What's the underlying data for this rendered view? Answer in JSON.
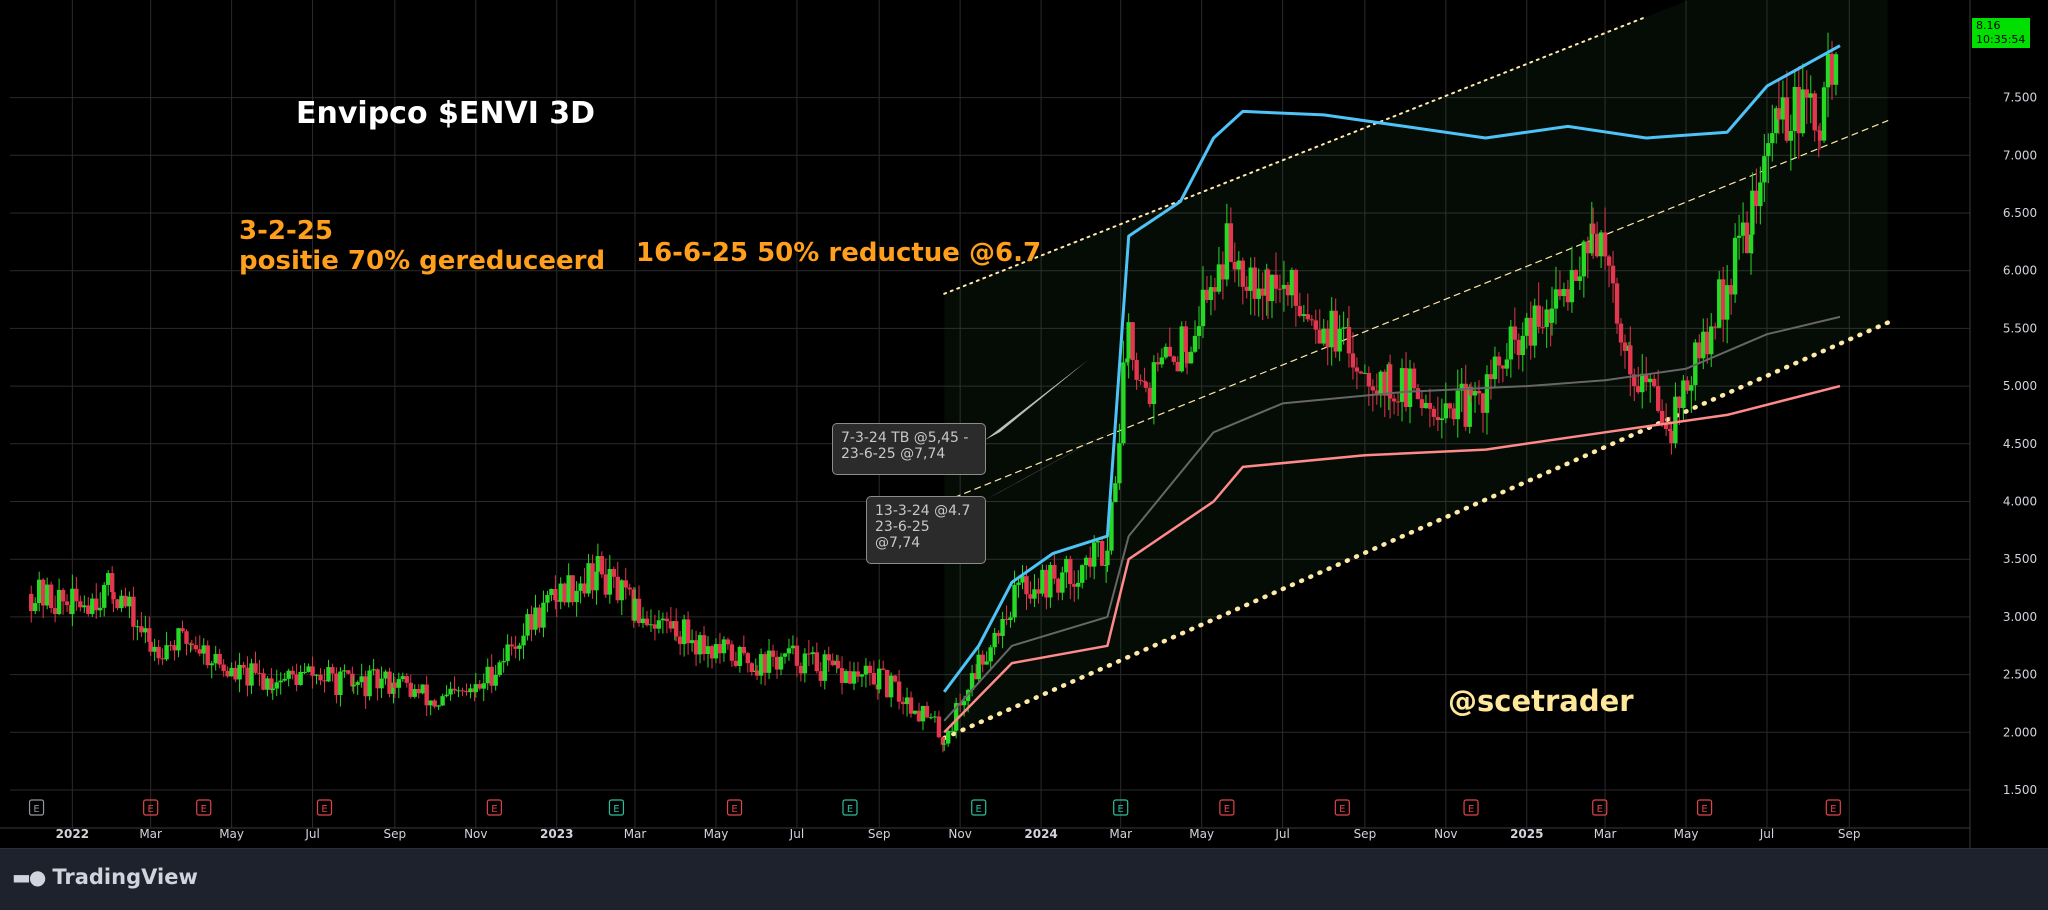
{
  "title": "Envipco $ENVI 3D",
  "annotations": {
    "note1_line1": "3-2-25",
    "note1_line2": "positie 70% gereduceerd",
    "note2": "16-6-25 50% reductue @6.7",
    "handle": "@scetrader",
    "callout1_line1": "7-3-24 TB @5,45 -",
    "callout1_line2": "23-6-25 @7,74",
    "callout2_line1": "13-3-24 @4.7",
    "callout2_line2": "23-6-25",
    "callout2_line3": "@7,74"
  },
  "price_badge": {
    "price": "8.16",
    "countdown": "10:35:54"
  },
  "branding": {
    "name": "TradingView",
    "icon": "tradingview-logo-icon"
  },
  "colors": {
    "up": "#26d926",
    "down": "#e3364f",
    "upper_band": "#4fc3f7",
    "lower_band": "#ff8a8a",
    "mid_band": "#666666",
    "channel": "#ffe9a8",
    "note": "#ff9f1c"
  },
  "chart_data": {
    "type": "candlestick",
    "timeframe": "3D",
    "symbol": "ENVI",
    "ylim": [
      1.5,
      8.2
    ],
    "y_ticks": [
      "1.500",
      "2.000",
      "2.500",
      "3.000",
      "3.500",
      "4.000",
      "4.500",
      "5.000",
      "5.500",
      "6.000",
      "6.500",
      "7.000",
      "7.500"
    ],
    "x_ticks": [
      "2022",
      "Mar",
      "May",
      "Jul",
      "Sep",
      "Nov",
      "2023",
      "Mar",
      "May",
      "Jul",
      "Sep",
      "Nov",
      "2024",
      "Mar",
      "May",
      "Jul",
      "Sep",
      "Nov",
      "2025",
      "Mar",
      "May",
      "Jul",
      "Sep"
    ],
    "price_path": [
      {
        "date": "2021-12-01",
        "close": 3.2
      },
      {
        "date": "2022-01-01",
        "close": 3.1
      },
      {
        "date": "2022-02-01",
        "close": 3.25
      },
      {
        "date": "2022-03-01",
        "close": 2.75
      },
      {
        "date": "2022-04-01",
        "close": 2.8
      },
      {
        "date": "2022-05-01",
        "close": 2.5
      },
      {
        "date": "2022-06-01",
        "close": 2.45
      },
      {
        "date": "2022-07-01",
        "close": 2.5
      },
      {
        "date": "2022-08-01",
        "close": 2.4
      },
      {
        "date": "2022-09-01",
        "close": 2.45
      },
      {
        "date": "2022-10-01",
        "close": 2.25
      },
      {
        "date": "2022-11-01",
        "close": 2.35
      },
      {
        "date": "2022-12-01",
        "close": 2.8
      },
      {
        "date": "2023-01-01",
        "close": 3.2
      },
      {
        "date": "2023-02-01",
        "close": 3.4
      },
      {
        "date": "2023-03-01",
        "close": 3.05
      },
      {
        "date": "2023-04-01",
        "close": 2.9
      },
      {
        "date": "2023-05-01",
        "close": 2.7
      },
      {
        "date": "2023-06-01",
        "close": 2.6
      },
      {
        "date": "2023-07-01",
        "close": 2.65
      },
      {
        "date": "2023-08-01",
        "close": 2.5
      },
      {
        "date": "2023-09-01",
        "close": 2.45
      },
      {
        "date": "2023-10-01",
        "close": 2.2
      },
      {
        "date": "2023-10-20",
        "close": 1.95
      },
      {
        "date": "2023-11-15",
        "close": 2.6
      },
      {
        "date": "2023-12-15",
        "close": 3.25
      },
      {
        "date": "2024-01-20",
        "close": 3.35
      },
      {
        "date": "2024-02-20",
        "close": 3.6
      },
      {
        "date": "2024-03-07",
        "close": 5.5
      },
      {
        "date": "2024-03-20",
        "close": 5.0
      },
      {
        "date": "2024-04-20",
        "close": 5.4
      },
      {
        "date": "2024-05-20",
        "close": 6.2
      },
      {
        "date": "2024-06-20",
        "close": 5.9
      },
      {
        "date": "2024-07-20",
        "close": 5.7
      },
      {
        "date": "2024-08-20",
        "close": 5.3
      },
      {
        "date": "2024-09-20",
        "close": 5.0
      },
      {
        "date": "2024-10-20",
        "close": 4.9
      },
      {
        "date": "2024-11-20",
        "close": 4.8
      },
      {
        "date": "2024-12-20",
        "close": 5.3
      },
      {
        "date": "2025-01-20",
        "close": 5.6
      },
      {
        "date": "2025-02-20",
        "close": 6.4
      },
      {
        "date": "2025-03-20",
        "close": 5.2
      },
      {
        "date": "2025-04-20",
        "close": 4.7
      },
      {
        "date": "2025-05-20",
        "close": 5.5
      },
      {
        "date": "2025-06-20",
        "close": 6.5
      },
      {
        "date": "2025-07-10",
        "close": 7.4
      },
      {
        "date": "2025-08-10",
        "close": 7.3
      },
      {
        "date": "2025-08-25",
        "close": 8.16
      }
    ],
    "upper_band": [
      {
        "date": "2023-10-20",
        "value": 2.35
      },
      {
        "date": "2023-11-15",
        "value": 2.75
      },
      {
        "date": "2023-12-10",
        "value": 3.3
      },
      {
        "date": "2024-01-10",
        "value": 3.55
      },
      {
        "date": "2024-02-20",
        "value": 3.7
      },
      {
        "date": "2024-03-07",
        "value": 6.3
      },
      {
        "date": "2024-04-15",
        "value": 6.6
      },
      {
        "date": "2024-05-10",
        "value": 7.15
      },
      {
        "date": "2024-06-01",
        "value": 7.38
      },
      {
        "date": "2024-08-01",
        "value": 7.35
      },
      {
        "date": "2024-10-01",
        "value": 7.25
      },
      {
        "date": "2024-12-01",
        "value": 7.15
      },
      {
        "date": "2025-02-01",
        "value": 7.25
      },
      {
        "date": "2025-04-01",
        "value": 7.15
      },
      {
        "date": "2025-06-01",
        "value": 7.2
      },
      {
        "date": "2025-07-01",
        "value": 7.6
      },
      {
        "date": "2025-08-25",
        "value": 7.95
      }
    ],
    "mid_band": [
      {
        "date": "2023-10-20",
        "value": 2.1
      },
      {
        "date": "2023-12-10",
        "value": 2.75
      },
      {
        "date": "2024-02-20",
        "value": 3.0
      },
      {
        "date": "2024-03-07",
        "value": 3.7
      },
      {
        "date": "2024-05-10",
        "value": 4.6
      },
      {
        "date": "2024-07-01",
        "value": 4.85
      },
      {
        "date": "2024-10-01",
        "value": 4.95
      },
      {
        "date": "2025-01-01",
        "value": 5.0
      },
      {
        "date": "2025-03-01",
        "value": 5.05
      },
      {
        "date": "2025-05-01",
        "value": 5.15
      },
      {
        "date": "2025-07-01",
        "value": 5.45
      },
      {
        "date": "2025-08-25",
        "value": 5.6
      }
    ],
    "lower_band": [
      {
        "date": "2023-10-20",
        "value": 2.0
      },
      {
        "date": "2023-12-10",
        "value": 2.6
      },
      {
        "date": "2024-02-20",
        "value": 2.75
      },
      {
        "date": "2024-03-07",
        "value": 3.5
      },
      {
        "date": "2024-05-10",
        "value": 4.0
      },
      {
        "date": "2024-06-01",
        "value": 4.3
      },
      {
        "date": "2024-09-01",
        "value": 4.4
      },
      {
        "date": "2024-12-01",
        "value": 4.45
      },
      {
        "date": "2025-03-01",
        "value": 4.6
      },
      {
        "date": "2025-06-01",
        "value": 4.75
      },
      {
        "date": "2025-08-25",
        "value": 5.0
      }
    ],
    "channel": {
      "lower": [
        {
          "date": "2023-10-20",
          "value": 1.95
        },
        {
          "date": "2025-09-30",
          "value": 5.55
        }
      ],
      "middle": [
        {
          "date": "2023-10-20",
          "value": 4.0
        },
        {
          "date": "2025-09-30",
          "value": 7.3
        }
      ],
      "upper": [
        {
          "date": "2023-10-20",
          "value": 5.8
        },
        {
          "date": "2025-04-01",
          "value": 8.2
        }
      ]
    },
    "event_markers": [
      {
        "date": "2021-12-05",
        "kind": "E",
        "color": "#9598a1"
      },
      {
        "date": "2022-03-01",
        "kind": "E",
        "color": "#e04545"
      },
      {
        "date": "2022-04-10",
        "kind": "E",
        "color": "#e04545"
      },
      {
        "date": "2022-07-10",
        "kind": "E",
        "color": "#e04545"
      },
      {
        "date": "2022-11-15",
        "kind": "E",
        "color": "#e04545"
      },
      {
        "date": "2023-02-15",
        "kind": "E",
        "color": "#2bbf9c"
      },
      {
        "date": "2023-05-15",
        "kind": "E",
        "color": "#e04545"
      },
      {
        "date": "2023-08-10",
        "kind": "E",
        "color": "#2bbf9c"
      },
      {
        "date": "2023-11-15",
        "kind": "E",
        "color": "#2bbf9c"
      },
      {
        "date": "2024-03-01",
        "kind": "E",
        "color": "#2bbf9c"
      },
      {
        "date": "2024-05-20",
        "kind": "E",
        "color": "#e04545"
      },
      {
        "date": "2024-08-15",
        "kind": "E",
        "color": "#e04545"
      },
      {
        "date": "2024-11-20",
        "kind": "E",
        "color": "#e04545"
      },
      {
        "date": "2025-02-25",
        "kind": "E",
        "color": "#e04545"
      },
      {
        "date": "2025-05-15",
        "kind": "E",
        "color": "#e04545"
      },
      {
        "date": "2025-08-20",
        "kind": "E",
        "color": "#e04545"
      }
    ]
  }
}
